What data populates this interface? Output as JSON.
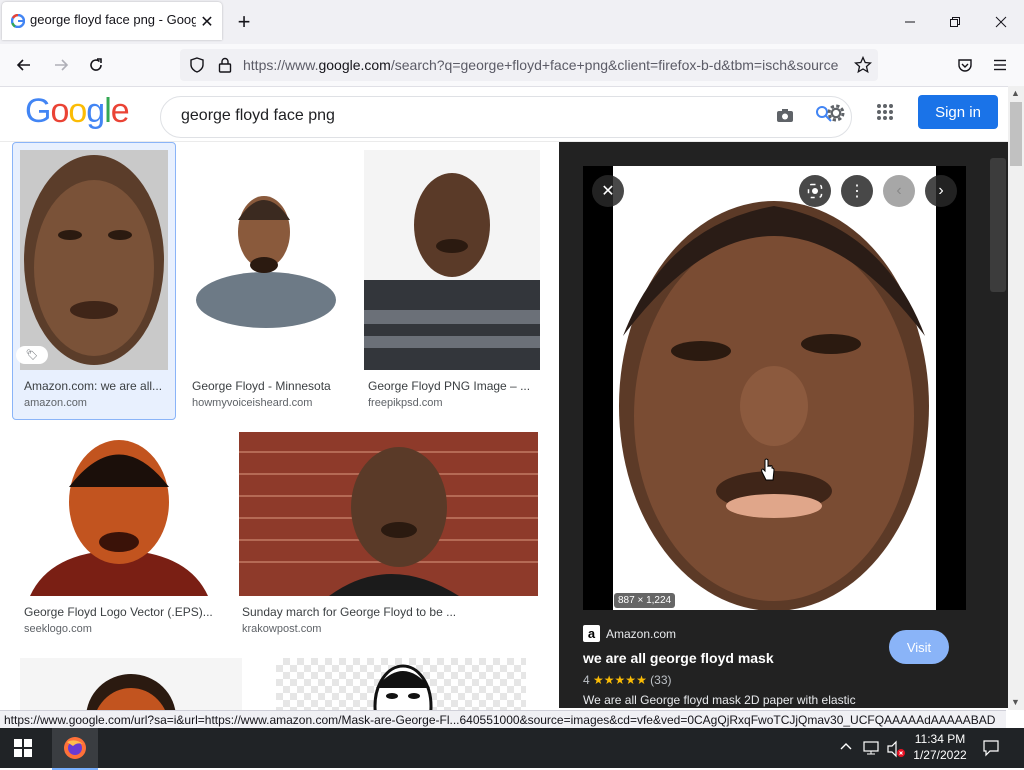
{
  "browser": {
    "tab_title": "george floyd face png - Google",
    "new_tab_symbol": "+",
    "window_controls": [
      "minimize",
      "maximize",
      "close"
    ],
    "url_prefix": "https://www.",
    "url_domain": "google.com",
    "url_rest": "/search?q=george+floyd+face+png&client=firefox-b-d&tbm=isch&source",
    "status_url": "https://www.google.com/url?sa=i&url=https://www.amazon.com/Mask-are-George-Fl...640551000&source=images&cd=vfe&ved=0CAgQjRxqFwoTCJjQmav30_UCFQAAAAAdAAAAABAD"
  },
  "google": {
    "query": "george floyd face png",
    "sign_in_label": "Sign in",
    "logo_letters": [
      {
        "ch": "G",
        "color": "#4285f4"
      },
      {
        "ch": "o",
        "color": "#ea4335"
      },
      {
        "ch": "o",
        "color": "#fbbc05"
      },
      {
        "ch": "g",
        "color": "#4285f4"
      },
      {
        "ch": "l",
        "color": "#34a853"
      },
      {
        "ch": "e",
        "color": "#ea4335"
      }
    ]
  },
  "results": [
    {
      "title": "Amazon.com: we are all...",
      "source": "amazon.com",
      "selected": true
    },
    {
      "title": "George Floyd - Minnesota",
      "source": "howmyvoiceisheard.com"
    },
    {
      "title": "George Floyd PNG Image – ...",
      "source": "freepikpsd.com"
    },
    {
      "title": "George Floyd Logo Vector (.EPS)...",
      "source": "seeklogo.com"
    },
    {
      "title": "Sunday march for George Floyd to be ...",
      "source": "krakowpost.com"
    }
  ],
  "preview": {
    "dimensions": "887 × 1,224",
    "source_name": "Amazon.com",
    "title": "we are all george floyd mask",
    "rating_value": "4",
    "stars": "★★★★★",
    "review_count": "(33)",
    "description": "We are all George floyd mask 2D paper with elastic",
    "visit_label": "Visit"
  },
  "taskbar": {
    "time": "11:34 PM",
    "date": "1/27/2022"
  },
  "colors": {
    "accent": "#1a73e8",
    "visit_button": "#8ab4f8",
    "star": "#fbbc05",
    "selected_border": "#8ab4f8"
  }
}
